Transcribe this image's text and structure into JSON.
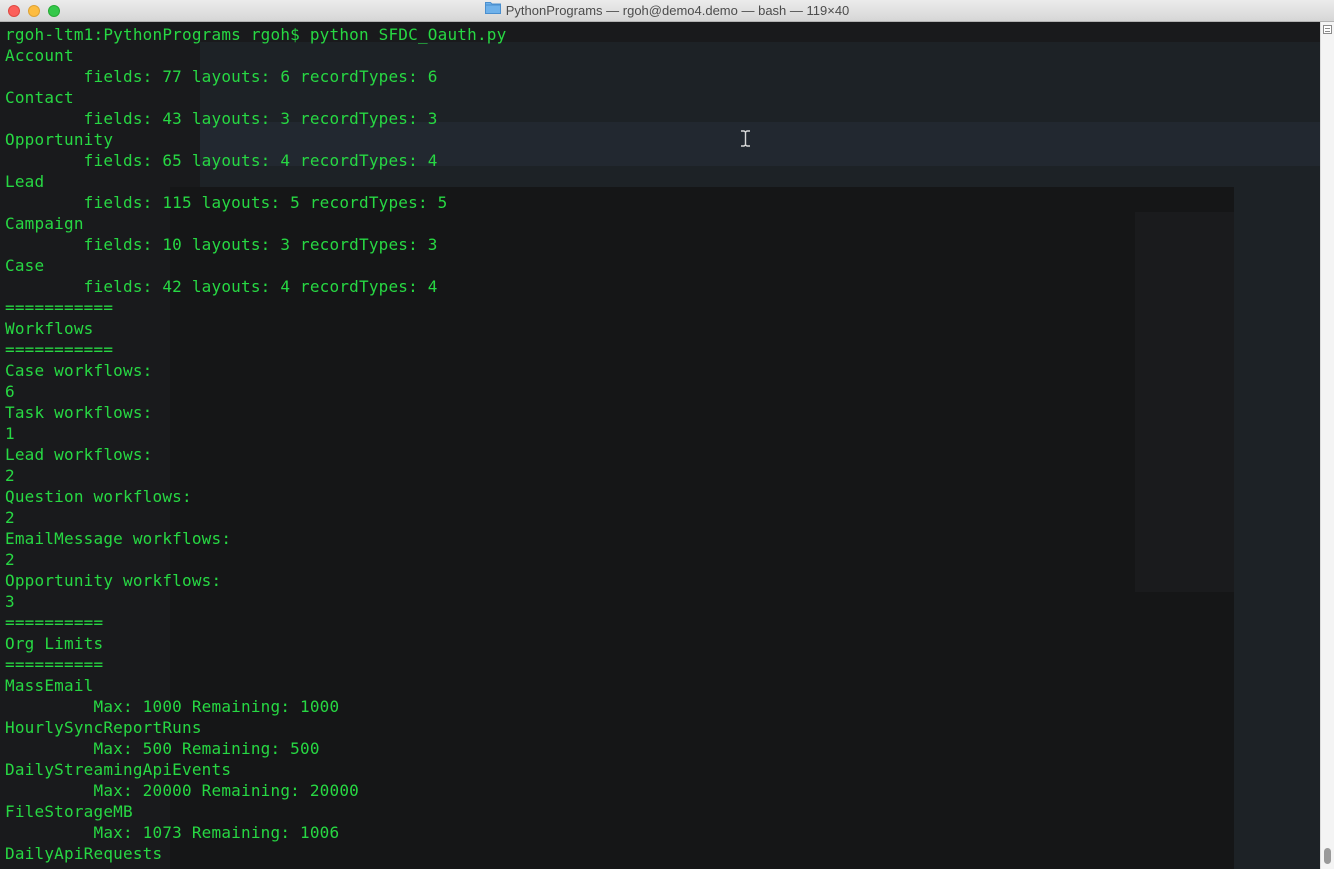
{
  "window": {
    "title": "PythonPrograms — rgoh@demo4.demo — bash — 119×40"
  },
  "terminal": {
    "lines": [
      "rgoh-ltm1:PythonPrograms rgoh$ python SFDC_Oauth.py",
      "Account",
      "        fields: 77 layouts: 6 recordTypes: 6",
      "Contact",
      "        fields: 43 layouts: 3 recordTypes: 3",
      "Opportunity",
      "        fields: 65 layouts: 4 recordTypes: 4",
      "Lead",
      "        fields: 115 layouts: 5 recordTypes: 5",
      "Campaign",
      "        fields: 10 layouts: 3 recordTypes: 3",
      "Case",
      "        fields: 42 layouts: 4 recordTypes: 4",
      "===========",
      "Workflows",
      "===========",
      "Case workflows:",
      "6",
      "Task workflows:",
      "1",
      "Lead workflows:",
      "2",
      "Question workflows:",
      "2",
      "EmailMessage workflows:",
      "2",
      "Opportunity workflows:",
      "3",
      "==========",
      "Org Limits",
      "==========",
      "MassEmail",
      "         Max: 1000 Remaining: 1000",
      "HourlySyncReportRuns",
      "         Max: 500 Remaining: 500",
      "DailyStreamingApiEvents",
      "         Max: 20000 Remaining: 20000",
      "FileStorageMB",
      "         Max: 1073 Remaining: 1006",
      "DailyApiRequests"
    ]
  },
  "colors": {
    "terminal_text": "#27d843",
    "terminal_background": "#191a1c",
    "titlebar": "#e3e3e3"
  },
  "icons": {
    "title_folder": "folder-icon",
    "cursor": "ibeam-cursor-icon",
    "scrollbar_button": "scroll-lines-icon"
  }
}
